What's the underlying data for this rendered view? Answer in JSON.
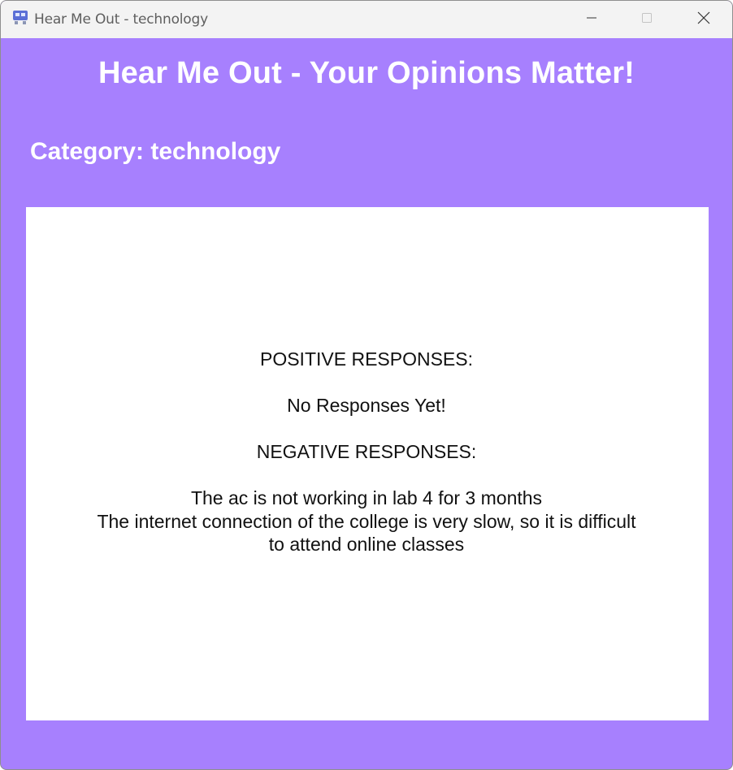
{
  "window": {
    "title": "Hear Me Out - technology",
    "buttons": {
      "minimize": "minimize",
      "maximize": "maximize",
      "close": "close"
    }
  },
  "header": {
    "title": "Hear Me Out - Your Opinions Matter!",
    "category": "Category: technology"
  },
  "responses": {
    "positive_heading": "POSITIVE RESPONSES:",
    "positive_items": [
      "No Responses Yet!"
    ],
    "negative_heading": "NEGATIVE RESPONSES:",
    "negative_items": [
      "The ac is not working in lab 4 for 3 months",
      "The internet connection of the college is very slow, so it is difficult",
      "to attend online classes"
    ]
  },
  "colors": {
    "background": "#a780fe",
    "panel": "#ffffff",
    "heading_text": "#ffffff"
  },
  "icons": {
    "app": "app-icon",
    "minimize": "minimize-icon",
    "maximize": "maximize-icon",
    "close": "close-icon"
  }
}
